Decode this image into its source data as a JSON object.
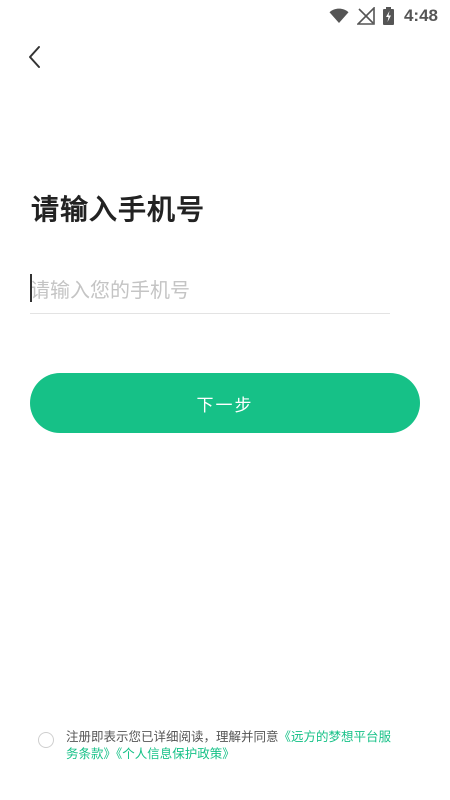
{
  "status_bar": {
    "time": "4:48",
    "icons": [
      "wifi-icon",
      "no-signal-icon",
      "battery-charging-icon"
    ]
  },
  "header": {
    "back_icon": "chevron-left-icon"
  },
  "main": {
    "title": "请输入手机号",
    "phone_input": {
      "value": "",
      "placeholder": "请输入您的手机号"
    },
    "next_button_label": "下一步"
  },
  "agreement": {
    "checked": false,
    "prefix": "注册即表示您已详细阅读，理解并同意",
    "terms_link": "《远方的梦想平台服务条款》",
    "privacy_link": "《个人信息保护政策》"
  },
  "colors": {
    "accent": "#16c187",
    "title_text": "#222222",
    "placeholder": "#c4c4c4",
    "body_text": "#555555"
  }
}
